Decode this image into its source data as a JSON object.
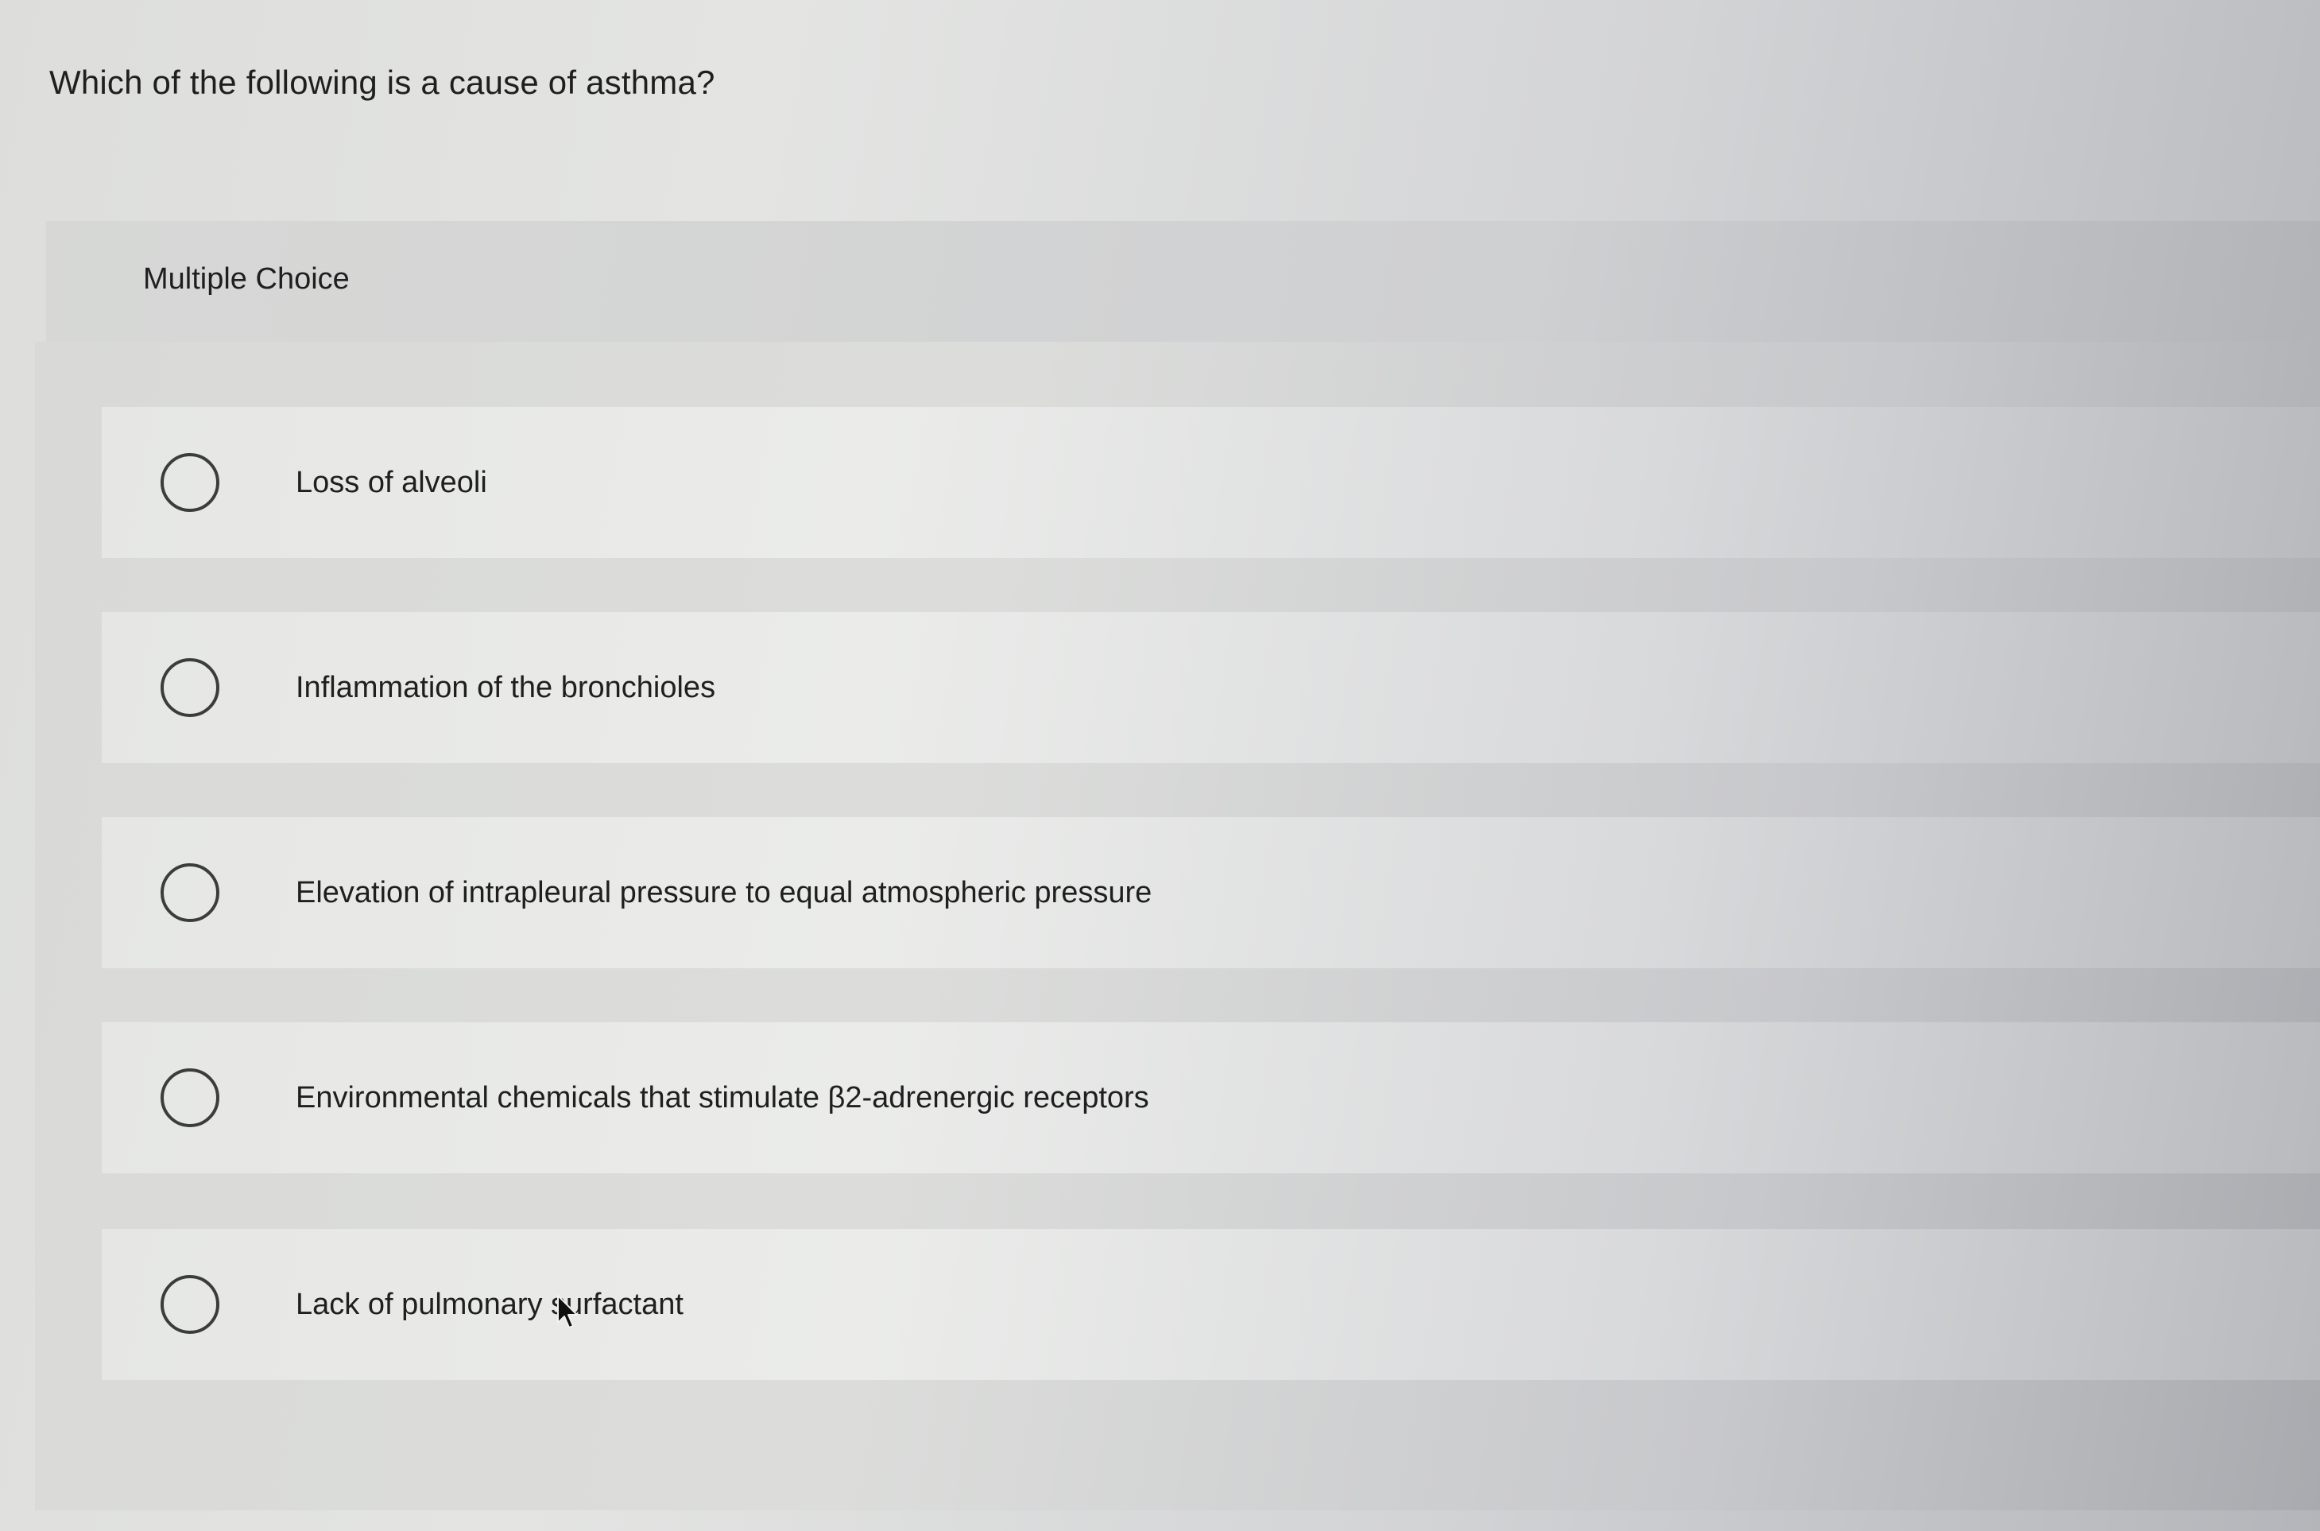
{
  "question": {
    "text": "Which of the following is a cause of asthma?"
  },
  "multiple_choice": {
    "label": "Multiple Choice",
    "options": [
      {
        "label": "Loss of alveoli",
        "selected": false
      },
      {
        "label": "Inflammation of the bronchioles",
        "selected": false
      },
      {
        "label": "Elevation of intrapleural pressure to equal atmospheric pressure",
        "selected": false
      },
      {
        "label": "Environmental chemicals that stimulate β2-adrenergic receptors",
        "selected": false
      },
      {
        "label": "Lack of pulmonary surfactant",
        "selected": false
      }
    ]
  },
  "icons": {
    "radio": "radio-unchecked-icon",
    "pointer": "mouse-pointer-icon"
  }
}
